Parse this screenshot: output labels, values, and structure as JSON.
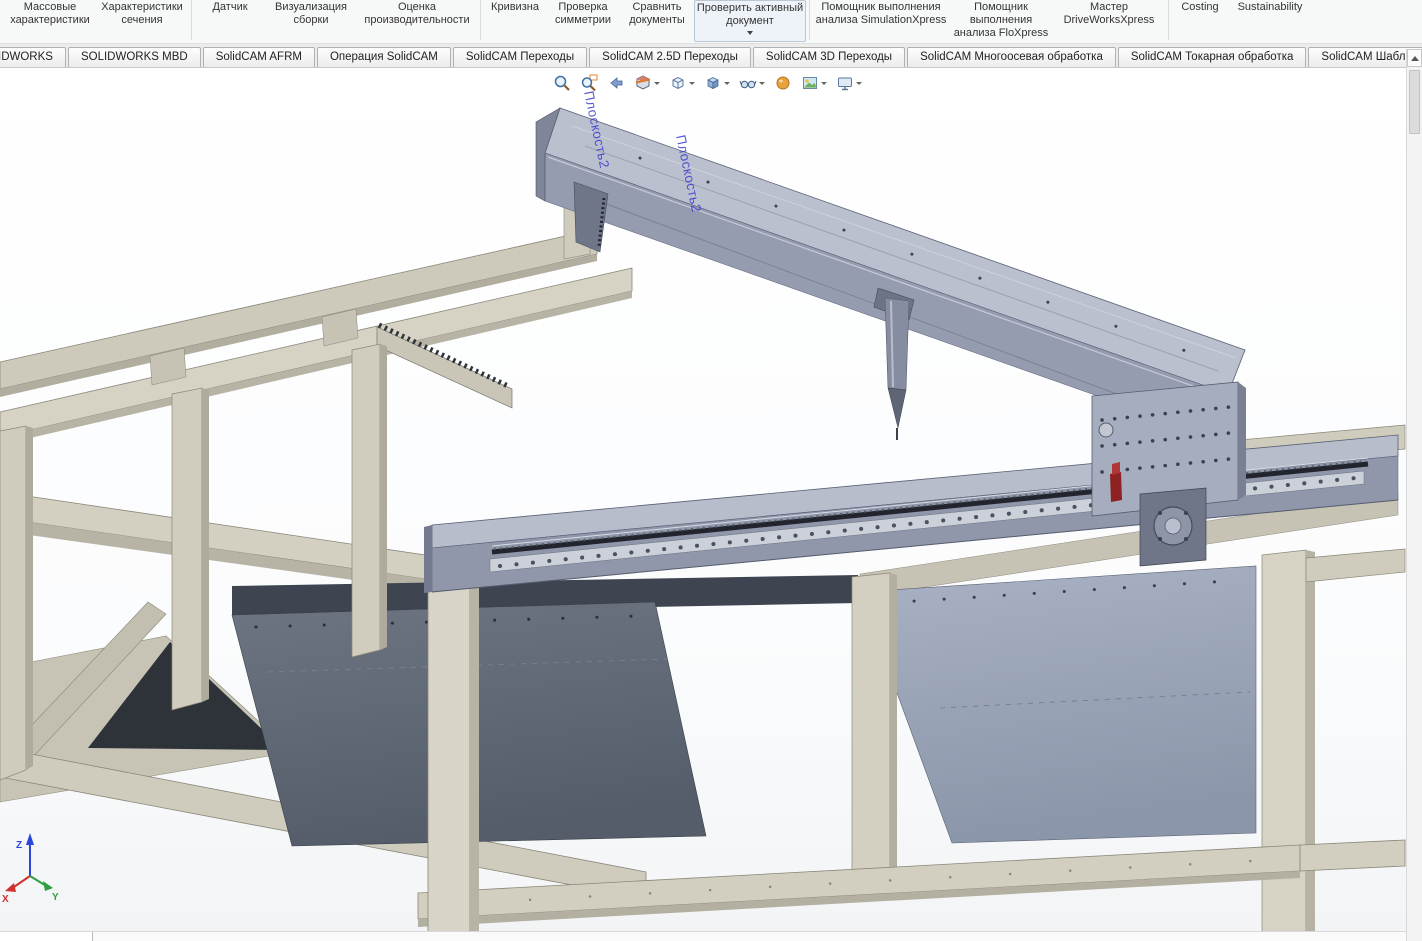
{
  "ribbon": {
    "items": [
      {
        "label": "Массовые характеристики"
      },
      {
        "label": "Характеристики сечения"
      },
      {
        "label": "Датчик"
      },
      {
        "label": "Визуализация сборки"
      },
      {
        "label": "Оценка производительности"
      },
      {
        "label": "Кривизна"
      },
      {
        "label": "Проверка симметрии"
      },
      {
        "label": "Сравнить документы"
      },
      {
        "label": "Проверить активный документ"
      },
      {
        "label": "Помощник выполнения анализа SimulationXpress"
      },
      {
        "label": "Помощник выполнения анализа FloXpress"
      },
      {
        "label": "Мастер DriveWorksXpress"
      },
      {
        "label": "Costing"
      },
      {
        "label": "Sustainability"
      }
    ]
  },
  "tabs": {
    "items": [
      {
        "label": "SOLIDWORKS"
      },
      {
        "label": "SOLIDWORKS MBD"
      },
      {
        "label": "SolidCAM AFRM"
      },
      {
        "label": "Операция SolidCAM"
      },
      {
        "label": "SolidCAM Переходы"
      },
      {
        "label": "SolidCAM 2.5D Переходы"
      },
      {
        "label": "SolidCAM 3D Переходы"
      },
      {
        "label": "SolidCAM Многоосевая обработка"
      },
      {
        "label": "SolidCAM Токарная обработка"
      },
      {
        "label": "SolidCAM Шаблоны"
      }
    ]
  },
  "heads_up_toolbar": {
    "icons": [
      "zoom-fit-icon",
      "zoom-area-icon",
      "previous-view-icon",
      "section-view-icon",
      "view-orientation-icon",
      "display-style-icon",
      "hide-show-items-icon",
      "edit-appearance-icon",
      "apply-scene-icon",
      "view-settings-icon"
    ]
  },
  "viewport": {
    "plane_labels": [
      "Плоскость2",
      "Плоскость2"
    ],
    "triad": {
      "z": "Z",
      "x": "X",
      "y": "Y"
    }
  },
  "colors": {
    "frame_tan": "#cfccbe",
    "rail_steel": "#9097ab",
    "gantry_steel": "#959cb0",
    "panel_dark": "#5a636f",
    "panel_light": "#9aa4b8",
    "plane_label_blue": "#3a3ad0",
    "motor_gray": "#6f7688",
    "accent_red": "#8e2222"
  }
}
